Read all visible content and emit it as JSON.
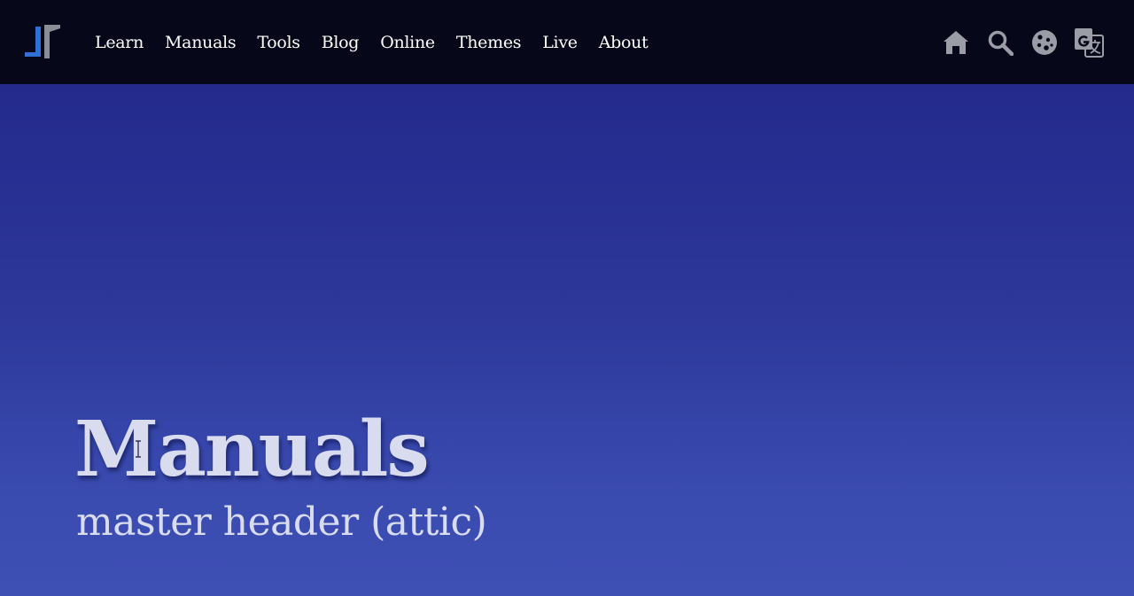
{
  "header": {
    "logo_icon": "jr-logo-icon",
    "nav": [
      {
        "label": "Learn"
      },
      {
        "label": "Manuals"
      },
      {
        "label": "Tools"
      },
      {
        "label": "Blog"
      },
      {
        "label": "Online"
      },
      {
        "label": "Themes"
      },
      {
        "label": "Live"
      },
      {
        "label": "About"
      }
    ],
    "actions": [
      {
        "icon": "home-icon"
      },
      {
        "icon": "search-icon"
      },
      {
        "icon": "cookie-icon"
      },
      {
        "icon": "translate-icon"
      }
    ]
  },
  "hero": {
    "title": "Manuals",
    "subtitle": "master header (attic)"
  },
  "colors": {
    "topbar_bg": "#06081a",
    "hero_top": "#232a8c",
    "hero_bottom": "#3f50b5",
    "hero_text": "#d8dcee",
    "icon_gray": "#9a9ca6",
    "logo_blue": "#2f6fd6",
    "logo_gray": "#8a8c96"
  }
}
